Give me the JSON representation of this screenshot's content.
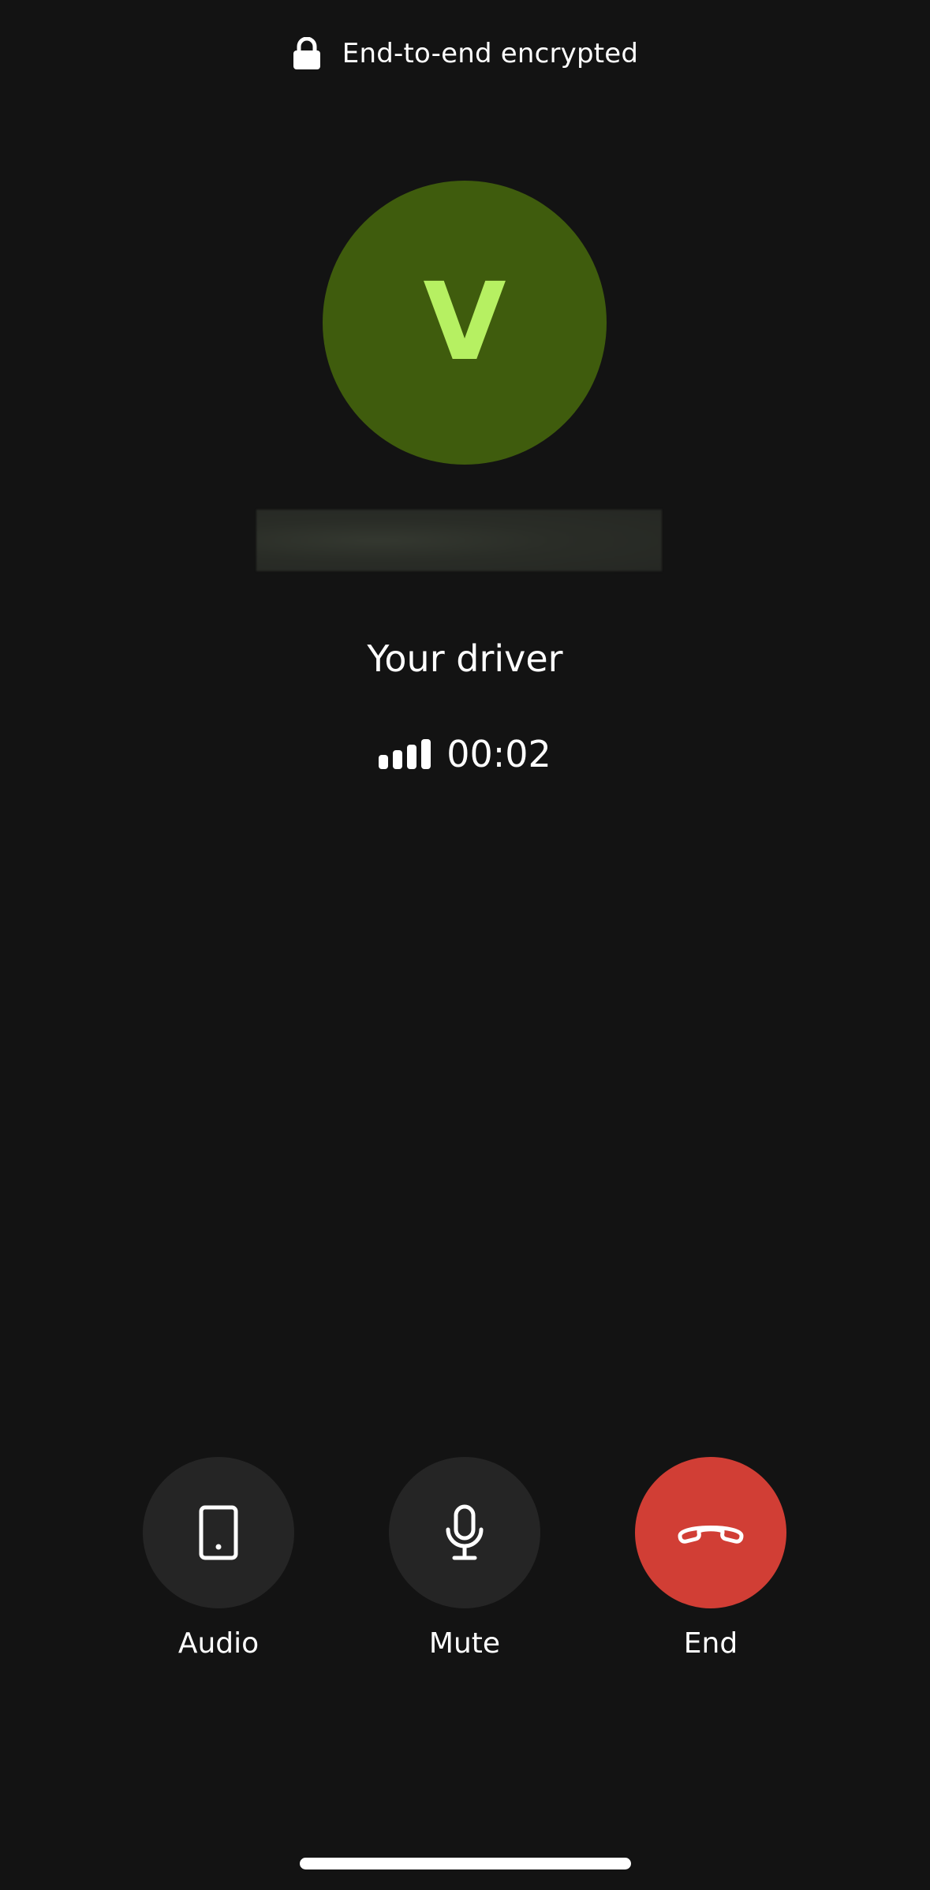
{
  "banner": {
    "icon": "lock-icon",
    "text": "End-to-end encrypted"
  },
  "caller": {
    "avatar_letter": "V",
    "avatar_color": "#3f5c0d",
    "avatar_letter_color": "#b6f062",
    "subtitle": "Your driver"
  },
  "status": {
    "icon": "signal-bars-icon",
    "timer": "00:02"
  },
  "controls": [
    {
      "icon": "phone-device-icon",
      "label": "Audio"
    },
    {
      "icon": "microphone-icon",
      "label": "Mute"
    },
    {
      "icon": "end-call-icon",
      "label": "End",
      "color": "#d13e35"
    }
  ]
}
